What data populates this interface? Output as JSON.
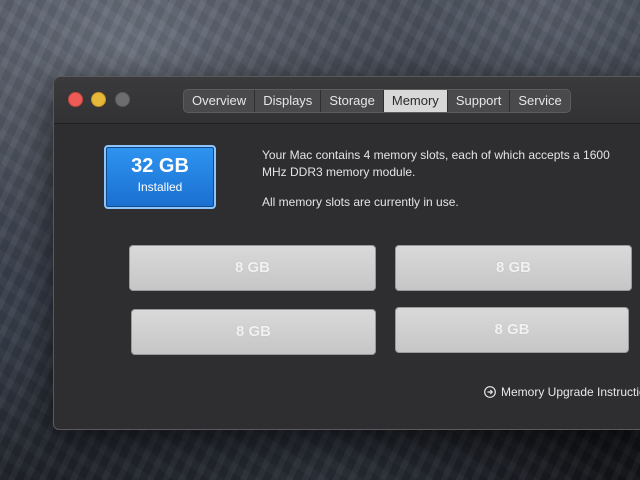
{
  "window": {
    "tabs": [
      {
        "label": "Overview",
        "active": false
      },
      {
        "label": "Displays",
        "active": false
      },
      {
        "label": "Storage",
        "active": false
      },
      {
        "label": "Memory",
        "active": true
      },
      {
        "label": "Support",
        "active": false
      },
      {
        "label": "Service",
        "active": false
      }
    ]
  },
  "memory": {
    "installed_amount": "32 GB",
    "installed_label": "Installed",
    "description_line1": "Your Mac contains 4 memory slots, each of which accepts a 1600 MHz DDR3 memory module.",
    "description_line2": "All memory slots are currently in use.",
    "slots": [
      {
        "label": "8 GB"
      },
      {
        "label": "8 GB"
      },
      {
        "label": "8 GB"
      },
      {
        "label": "8 GB"
      }
    ],
    "upgrade_link": "Memory Upgrade Instructio",
    "upgrade_icon": "arrow-circle-icon"
  },
  "colors": {
    "installed_badge": "#1f7fe0",
    "window_bg": "#2e2e30",
    "slot_bg": "#d0d0d0",
    "close_button": "#ec5b55",
    "minimize_button": "#e6b83a"
  }
}
